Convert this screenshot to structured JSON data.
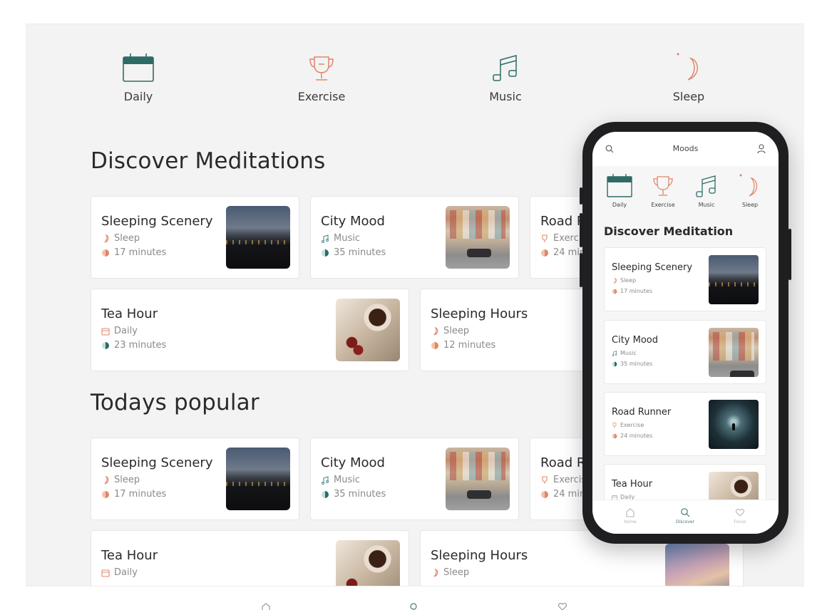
{
  "colors": {
    "accent_teal": "#2f6b66",
    "accent_coral": "#e0876a",
    "background": "#f3f3f3",
    "card": "#ffffff"
  },
  "categories": [
    {
      "label": "Daily",
      "icon": "calendar-icon"
    },
    {
      "label": "Exercise",
      "icon": "trophy-icon"
    },
    {
      "label": "Music",
      "icon": "music-note-icon"
    },
    {
      "label": "Sleep",
      "icon": "moon-icon"
    }
  ],
  "tablet": {
    "discover_title": "Discover Meditations",
    "popular_title": "Todays popular",
    "discover_cards": [
      {
        "title": "Sleeping Scenery",
        "category": "Sleep",
        "duration": "17 minutes",
        "category_icon": "moon-icon",
        "thumb": "scenery"
      },
      {
        "title": "City Mood",
        "category": "Music",
        "duration": "35 minutes",
        "category_icon": "music-note-icon",
        "thumb": "city"
      },
      {
        "title": "Road R",
        "category": "Exercis",
        "duration": "24 min",
        "category_icon": "trophy-icon",
        "thumb": "road"
      },
      {
        "title": "Tea Hour",
        "category": "Daily",
        "duration": "23 minutes",
        "category_icon": "calendar-icon",
        "thumb": "tea"
      },
      {
        "title": "Sleeping Hours",
        "category": "Sleep",
        "duration": "12 minutes",
        "category_icon": "moon-icon",
        "thumb": "girl"
      }
    ],
    "popular_cards": [
      {
        "title": "Sleeping Scenery",
        "category": "Sleep",
        "duration": "17 minutes",
        "category_icon": "moon-icon",
        "thumb": "scenery"
      },
      {
        "title": "City Mood",
        "category": "Music",
        "duration": "35 minutes",
        "category_icon": "music-note-icon",
        "thumb": "city"
      },
      {
        "title": "Road R",
        "category": "Exercis",
        "duration": "24 min",
        "category_icon": "trophy-icon",
        "thumb": "road"
      },
      {
        "title": "Tea Hour",
        "category": "Daily",
        "duration": "",
        "category_icon": "calendar-icon",
        "thumb": "tea"
      },
      {
        "title": "Sleeping Hours",
        "category": "Sleep",
        "duration": "",
        "category_icon": "moon-icon",
        "thumb": "girl"
      }
    ]
  },
  "phone": {
    "header_title": "Moods",
    "section_title": "Discover Meditation",
    "cards": [
      {
        "title": "Sleeping Scenery",
        "category": "Sleep",
        "duration": "17 minutes",
        "category_icon": "moon-icon",
        "thumb": "scenery"
      },
      {
        "title": "City Mood",
        "category": "Music",
        "duration": "35 minutes",
        "category_icon": "music-note-icon",
        "thumb": "city"
      },
      {
        "title": "Road Runner",
        "category": "Exercise",
        "duration": "24 minutes",
        "category_icon": "trophy-icon",
        "thumb": "road"
      },
      {
        "title": "Tea Hour",
        "category": "Daily",
        "duration": "",
        "category_icon": "calendar-icon",
        "thumb": "tea"
      }
    ],
    "tabs": [
      {
        "label": "Home",
        "icon": "home-icon"
      },
      {
        "label": "Discover",
        "icon": "search-icon"
      },
      {
        "label": "Focus",
        "icon": "heart-icon"
      }
    ]
  }
}
